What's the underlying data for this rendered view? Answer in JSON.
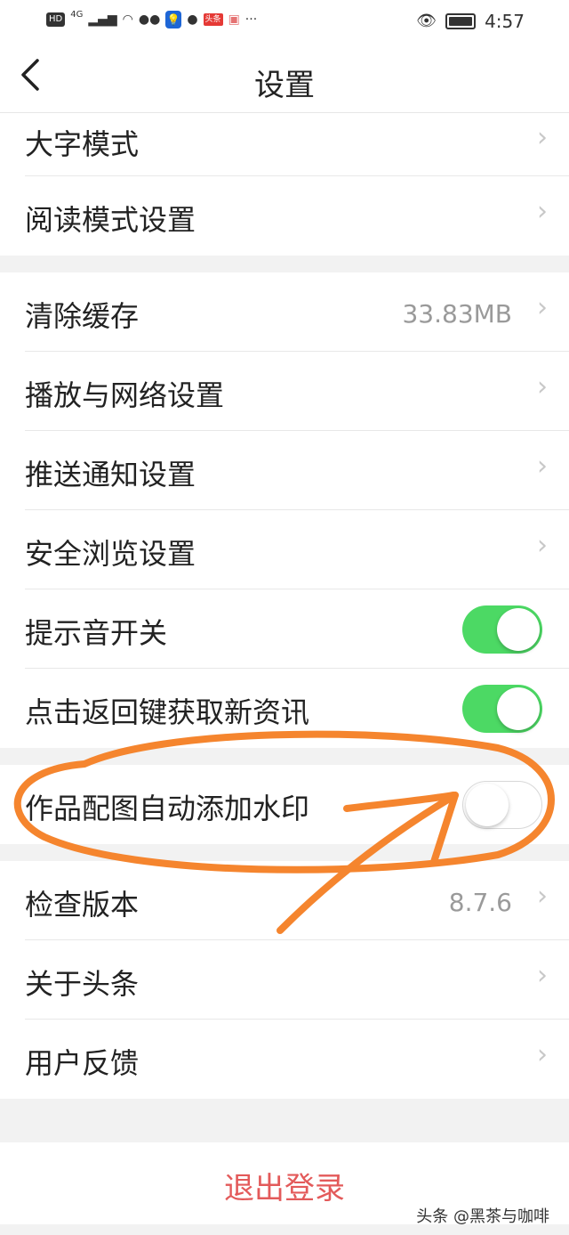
{
  "status": {
    "hd": "HD",
    "net": "4G",
    "toutiao": "头条",
    "more": "···",
    "time": "4:57"
  },
  "header": {
    "title": "设置"
  },
  "group1": [
    {
      "label": "大字模式"
    },
    {
      "label": "阅读模式设置"
    }
  ],
  "group2": [
    {
      "label": "清除缓存",
      "value": "33.83MB"
    },
    {
      "label": "播放与网络设置"
    },
    {
      "label": "推送通知设置"
    },
    {
      "label": "安全浏览设置"
    },
    {
      "label": "提示音开关",
      "toggle": "on"
    },
    {
      "label": "点击返回键获取新资讯",
      "toggle": "on"
    }
  ],
  "group3": [
    {
      "label": "作品配图自动添加水印",
      "toggle": "off"
    }
  ],
  "group4": [
    {
      "label": "检查版本",
      "value": "8.7.6"
    },
    {
      "label": "关于头条"
    },
    {
      "label": "用户反馈"
    }
  ],
  "logout": {
    "label": "退出登录"
  },
  "watermark": "头条 @黑茶与咖啡",
  "colors": {
    "toggle_on": "#4cd964",
    "logout_text": "#e35a5a",
    "annotation": "#f5852e"
  },
  "icons": {
    "back": "chevron-left-icon",
    "row_arrow": "chevron-right-icon"
  }
}
